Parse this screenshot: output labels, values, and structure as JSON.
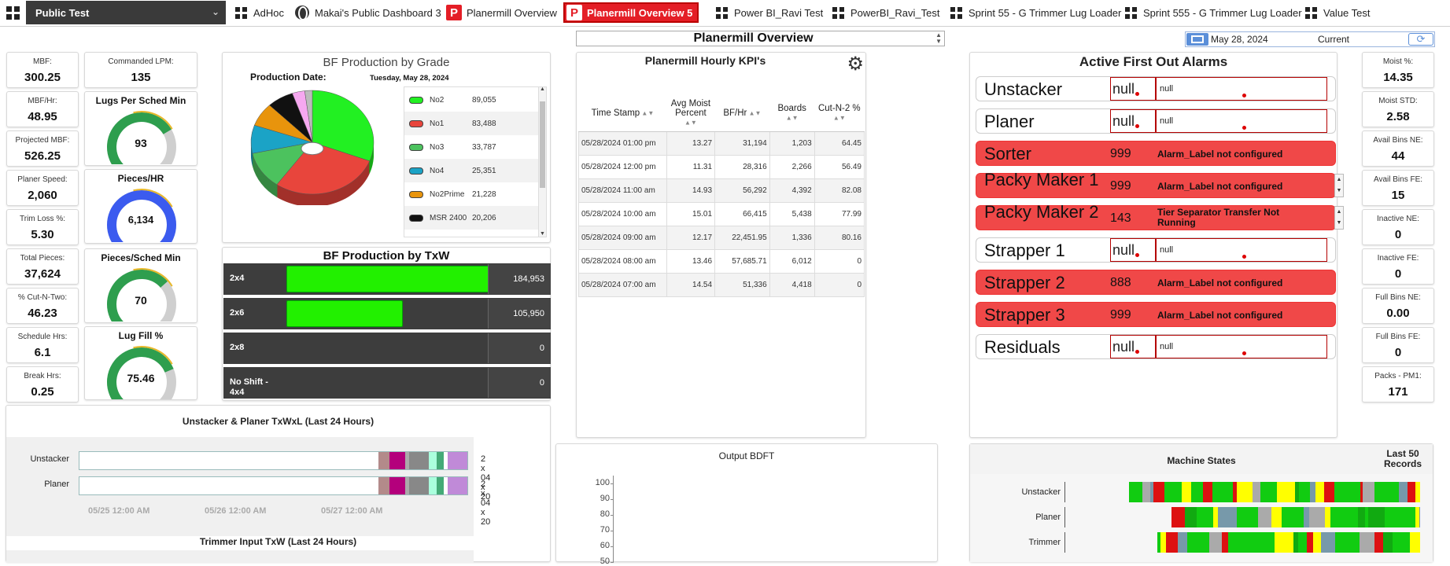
{
  "topbar": {
    "project": "Public Test",
    "tabs": [
      {
        "label": "AdHoc",
        "icon": "grid-icon"
      },
      {
        "label": "Makai's Public Dashboard 3",
        "icon": "globe-icon"
      },
      {
        "label": "Planermill Overview",
        "icon": "p-logo-icon"
      },
      {
        "label": "Planermill Overview 5",
        "icon": "p-logo-icon",
        "active": true
      },
      {
        "label": "Power BI_Ravi Test",
        "icon": "grid-icon"
      },
      {
        "label": "PowerBI_Ravi_Test",
        "icon": "grid-icon"
      },
      {
        "label": "Sprint 55 - G Trimmer Lug Loader",
        "icon": "grid-icon"
      },
      {
        "label": "Sprint 555 - G Trimmer Lug Loader",
        "icon": "grid-icon"
      },
      {
        "label": "Value Test",
        "icon": "grid-icon"
      }
    ]
  },
  "header": {
    "view_select": "Planermill Overview",
    "date": "May 28, 2024",
    "current_label": "Current"
  },
  "left_metrics": [
    {
      "label": "MBF:",
      "value": "300.25"
    },
    {
      "label": "MBF/Hr:",
      "value": "48.95"
    },
    {
      "label": "Projected MBF:",
      "value": "526.25"
    },
    {
      "label": "Planer Speed:",
      "value": "2,060"
    },
    {
      "label": "Trim Loss %:",
      "value": "5.30"
    },
    {
      "label": "Total Pieces:",
      "value": "37,624"
    },
    {
      "label": "% Cut-N-Two:",
      "value": "46.23"
    },
    {
      "label": "Schedule Hrs:",
      "value": "6.1"
    },
    {
      "label": "Break Hrs:",
      "value": "0.25"
    }
  ],
  "commanded": {
    "label": "Commanded LPM:",
    "value": "135"
  },
  "gauges": [
    {
      "title": "Lugs Per Sched Min",
      "value": "93",
      "fraction": 0.72,
      "color": "#2e9e4e"
    },
    {
      "title": "Pieces/HR",
      "value": "6,134",
      "fraction": 1.0,
      "color": "#3b5bef"
    },
    {
      "title": "Pieces/Sched Min",
      "value": "70",
      "fraction": 0.68,
      "color": "#2e9e4e"
    },
    {
      "title": "Lug Fill %",
      "value": "75.46",
      "fraction": 0.75,
      "color": "#2e9e4e"
    }
  ],
  "bf_grade": {
    "title": "BF Production by Grade",
    "date_label": "Production Date:",
    "date_value": "Tuesday, May 28, 2024",
    "legend": [
      {
        "name": "No2",
        "value": "89,055",
        "color": "#22f022"
      },
      {
        "name": "No1",
        "value": "83,488",
        "color": "#e8453c"
      },
      {
        "name": "No3",
        "value": "33,787",
        "color": "#4cc25e"
      },
      {
        "name": "No4",
        "value": "25,351",
        "color": "#1ba3c6"
      },
      {
        "name": "No2Prime",
        "value": "21,228",
        "color": "#e8940c"
      },
      {
        "name": "MSR 2400",
        "value": "20,206",
        "color": "#111111"
      }
    ]
  },
  "chart_data": {
    "type": "pie",
    "title": "BF Production by Grade",
    "categories": [
      "No2",
      "No1",
      "No3",
      "No4",
      "No2Prime",
      "MSR 2400"
    ],
    "values": [
      89055,
      83488,
      33787,
      25351,
      21228,
      20206
    ],
    "extra_slices_colors": [
      "#f6a8f0",
      "#bbbbbb"
    ]
  },
  "txw": {
    "title": "BF Production by TxW",
    "rows": [
      {
        "label": "2x4",
        "value": "184,953",
        "fraction": 1.0
      },
      {
        "label": "2x6",
        "value": "105,950",
        "fraction": 0.57
      },
      {
        "label": "2x8",
        "value": "0",
        "fraction": 0
      },
      {
        "label": "No Shift - 4x4",
        "value": "0",
        "fraction": 0
      }
    ]
  },
  "kpi": {
    "title": "Planermill Hourly KPI's",
    "columns": [
      "Time Stamp",
      "Avg Moist Percent",
      "BF/Hr",
      "Boards",
      "Cut-N-2 %"
    ],
    "rows": [
      [
        "05/28/2024 01:00 pm",
        "13.27",
        "31,194",
        "1,203",
        "64.45"
      ],
      [
        "05/28/2024 12:00 pm",
        "11.31",
        "28,316",
        "2,266",
        "56.49"
      ],
      [
        "05/28/2024 11:00 am",
        "14.93",
        "56,292",
        "4,392",
        "82.08"
      ],
      [
        "05/28/2024 10:00 am",
        "15.01",
        "66,415",
        "5,438",
        "77.99"
      ],
      [
        "05/28/2024 09:00 am",
        "12.17",
        "22,451.95",
        "1,336",
        "80.16"
      ],
      [
        "05/28/2024 08:00 am",
        "13.46",
        "57,685.71",
        "6,012",
        "0"
      ],
      [
        "05/28/2024 07:00 am",
        "14.54",
        "51,336",
        "4,418",
        "0"
      ]
    ]
  },
  "alarms": {
    "title": "Active First Out Alarms",
    "items": [
      {
        "name": "Unstacker",
        "code": "null",
        "desc": "null",
        "state": "ok"
      },
      {
        "name": "Planer",
        "code": "null",
        "desc": "null",
        "state": "ok"
      },
      {
        "name": "Sorter",
        "code": "999",
        "desc": "Alarm_Label not configured",
        "state": "bad"
      },
      {
        "name": "Packy Maker 1",
        "code": "999",
        "desc": "Alarm_Label not configured",
        "state": "bad",
        "scroll": true
      },
      {
        "name": "Packy Maker 2",
        "code": "143",
        "desc": "Tier Separator Transfer Not Running",
        "state": "bad",
        "scroll": true
      },
      {
        "name": "Strapper 1",
        "code": "null",
        "desc": "null",
        "state": "ok"
      },
      {
        "name": "Strapper 2",
        "code": "888",
        "desc": "Alarm_Label not configured",
        "state": "bad"
      },
      {
        "name": "Strapper 3",
        "code": "999",
        "desc": "Alarm_Label not configured",
        "state": "bad"
      },
      {
        "name": "Residuals",
        "code": "null",
        "desc": "null",
        "state": "ok"
      }
    ]
  },
  "right_metrics": [
    {
      "label": "Moist %:",
      "value": "14.35"
    },
    {
      "label": "Moist STD:",
      "value": "2.58"
    },
    {
      "label": "Avail Bins NE:",
      "value": "44"
    },
    {
      "label": "Avail Bins FE:",
      "value": "15"
    },
    {
      "label": "Inactive NE:",
      "value": "0"
    },
    {
      "label": "Inactive FE:",
      "value": "0"
    },
    {
      "label": "Full Bins NE:",
      "value": "0.00"
    },
    {
      "label": "Full Bins FE:",
      "value": "0"
    },
    {
      "label": "Packs - PM1:",
      "value": "171"
    }
  ],
  "txwxl": {
    "title": "Unstacker & Planer TxWxL (Last 24 Hours)",
    "rows": [
      {
        "label": "Unstacker",
        "value": "2 x 04 x 20"
      },
      {
        "label": "Planer",
        "value": "2 x 04 x 20"
      }
    ],
    "ticks": [
      "05/25 12:00 AM",
      "05/26 12:00 AM",
      "05/27 12:00 AM"
    ],
    "next_title": "Trimmer Input TxW (Last 24 Hours)"
  },
  "output": {
    "title": "Output BDFT",
    "yticks": [
      "100",
      "90",
      "80",
      "70",
      "60",
      "50"
    ]
  },
  "machine_states": {
    "title": "Machine States",
    "subtitle": "Last 50 Records",
    "rows": [
      "Unstacker",
      "Planer",
      "Trimmer"
    ]
  }
}
